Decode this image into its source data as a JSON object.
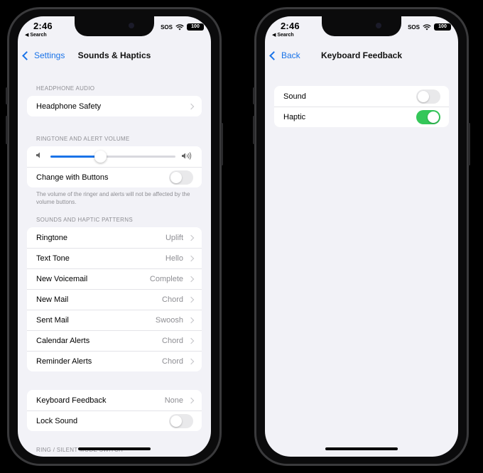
{
  "status": {
    "time": "2:46",
    "back_app": "◀ Search",
    "sos": "SOS",
    "battery": "100",
    "wifi_icon": "wifi-icon"
  },
  "left": {
    "nav": {
      "back_label": "Settings",
      "title": "Sounds & Haptics"
    },
    "headphone_header": "HEADPHONE AUDIO",
    "headphone_safety": "Headphone Safety",
    "ringtone_header": "RINGTONE AND ALERT VOLUME",
    "volume_level": 0.4,
    "change_with_buttons": {
      "label": "Change with Buttons",
      "on": false
    },
    "volume_footnote": "The volume of the ringer and alerts will not be affected by the volume buttons.",
    "patterns_header": "SOUNDS AND HAPTIC PATTERNS",
    "patterns": [
      {
        "label": "Ringtone",
        "value": "Uplift"
      },
      {
        "label": "Text Tone",
        "value": "Hello"
      },
      {
        "label": "New Voicemail",
        "value": "Complete"
      },
      {
        "label": "New Mail",
        "value": "Chord"
      },
      {
        "label": "Sent Mail",
        "value": "Swoosh"
      },
      {
        "label": "Calendar Alerts",
        "value": "Chord"
      },
      {
        "label": "Reminder Alerts",
        "value": "Chord"
      }
    ],
    "keyboard_feedback": {
      "label": "Keyboard Feedback",
      "value": "None"
    },
    "lock_sound": {
      "label": "Lock Sound",
      "on": false
    },
    "switch_header": "RING / SILENT MODE SWITCH"
  },
  "right": {
    "nav": {
      "back_label": "Back",
      "title": "Keyboard Feedback"
    },
    "sound": {
      "label": "Sound",
      "on": false
    },
    "haptic": {
      "label": "Haptic",
      "on": true
    }
  },
  "colors": {
    "accent": "#1a73e8",
    "toggle_on": "#34c759",
    "background": "#f2f2f7"
  }
}
